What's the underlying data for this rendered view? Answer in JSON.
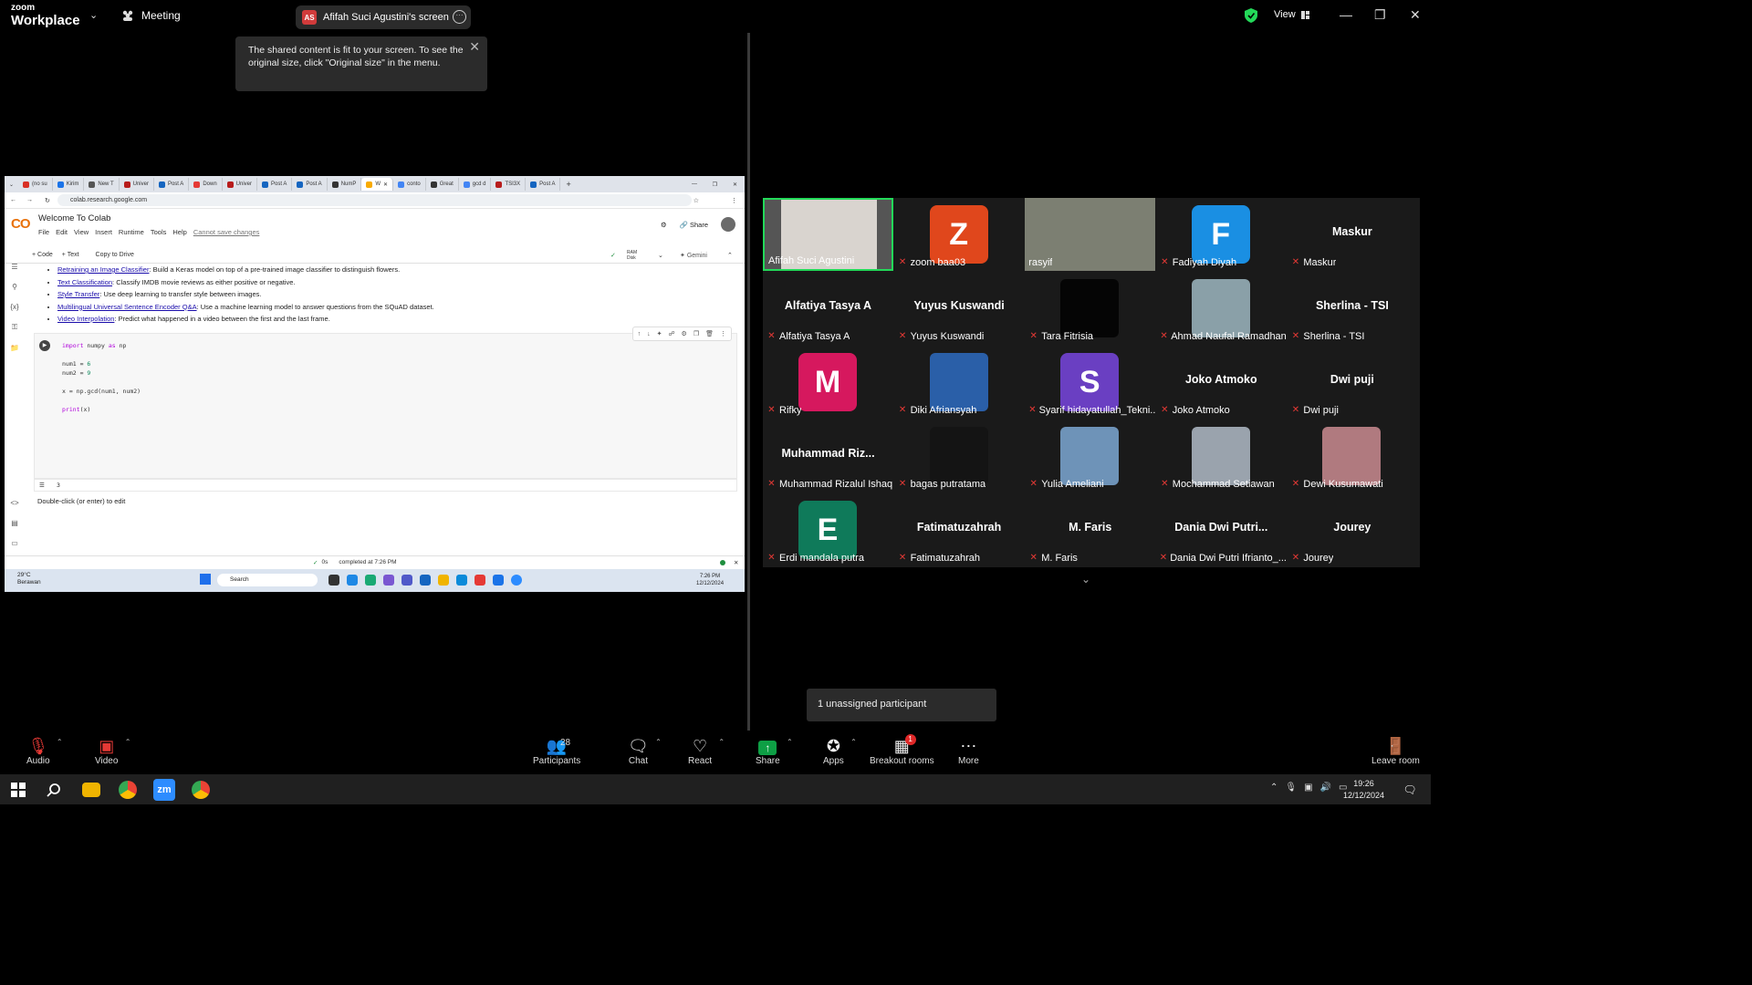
{
  "app": {
    "logo_top": "zoom",
    "logo_bottom": "Workplace",
    "meeting_label": "Meeting",
    "view_label": "View"
  },
  "share_pill": {
    "initials": "AS",
    "label": "Afifah Suci Agustini's screen"
  },
  "tooltip": {
    "text": "The shared content is fit to your screen. To see the original size, click \"Original size\" in the menu."
  },
  "shared": {
    "tabs": [
      "(no su",
      "Kirim",
      "New T",
      "Univer",
      "Post A",
      "Down",
      "Univer",
      "Post A",
      "Post A",
      "NumP",
      "W",
      "conto",
      "Great",
      "gcd d",
      "TSI3X",
      "Post A"
    ],
    "tab_colors": [
      "#d93025",
      "#1a73e8",
      "#555",
      "#b71c1c",
      "#1565c0",
      "#e53935",
      "#b71c1c",
      "#1565c0",
      "#1565c0",
      "#333",
      "#f9ab00",
      "#4285f4",
      "#333",
      "#4285f4",
      "#b71c1c",
      "#1565c0"
    ],
    "url": "colab.research.google.com",
    "colab_logo": "CO",
    "notebook_title": "Welcome To Colab",
    "menu": [
      "File",
      "Edit",
      "View",
      "Insert",
      "Runtime",
      "Tools",
      "Help"
    ],
    "readonly_note": "Cannot save changes",
    "share": "Share",
    "add_code": "+ Code",
    "add_text": "+ Text",
    "copy_drive": "Copy to Drive",
    "ram": "RAM",
    "disk": "Disk",
    "gemini": "Gemini",
    "bullets": [
      {
        "link": "Retraining an Image Classifier",
        "text": ": Build a Keras model on top of a pre-trained image classifier to distinguish flowers."
      },
      {
        "link": "Text Classification",
        "text": ": Classify IMDB movie reviews as either positive or negative."
      },
      {
        "link": "Style Transfer",
        "text": ": Use deep learning to transfer style between images."
      },
      {
        "link": "Multilingual Universal Sentence Encoder Q&A",
        "text": ": Use a machine learning model to answer questions from the SQuAD dataset."
      },
      {
        "link": "Video Interpolation",
        "text": ": Predict what happened in a video between the first and the last frame."
      }
    ],
    "code": {
      "l1_kw": "import",
      "l1_rest": " numpy ",
      "l1_as": "as",
      "l1_np": " np",
      "l2": "num1 = ",
      "l2_n": "6",
      "l3": "num2 = ",
      "l3_n": "9",
      "l4": "x = np.gcd(num1, num2)",
      "l5_kw": "print",
      "l5_rest": "(x)"
    },
    "output": "3",
    "hint": "Double-click (or enter) to edit",
    "status_time": "0s",
    "status_text": "completed at 7:26 PM",
    "weather_temp": "29°C",
    "weather_desc": "Berawan",
    "search_label": "Search",
    "inner_clock_time": "7:26 PM",
    "inner_clock_date": "12/12/2024"
  },
  "gallery": [
    {
      "name": "Afifah Suci Agustini",
      "kind": "video",
      "muted": false,
      "active": true
    },
    {
      "name": "zoom baa03",
      "kind": "avatar",
      "letter": "Z",
      "color": "#e0471c",
      "muted": true
    },
    {
      "name": "rasyif",
      "kind": "video",
      "muted": false
    },
    {
      "name": "Fadiyah Diyah",
      "kind": "avatar",
      "letter": "F",
      "color": "#1a8fe3",
      "muted": true
    },
    {
      "name": "Maskur",
      "kind": "name",
      "big": "Maskur",
      "muted": true
    },
    {
      "name": "Alfatiya Tasya A",
      "kind": "name",
      "big": "Alfatiya Tasya A",
      "muted": true
    },
    {
      "name": "Yuyus Kuswandi",
      "kind": "name",
      "big": "Yuyus Kuswandi",
      "muted": true
    },
    {
      "name": "Tara Fitrisia",
      "kind": "photo",
      "color": "#050505",
      "muted": true
    },
    {
      "name": "Ahmad Naufal Ramadhan",
      "kind": "photo",
      "color": "#8aa0a8",
      "muted": true
    },
    {
      "name": "Sherlina - TSI",
      "kind": "name",
      "big": "Sherlina - TSI",
      "muted": true
    },
    {
      "name": "Rifky",
      "kind": "avatar",
      "letter": "M",
      "color": "#d6185e",
      "muted": true
    },
    {
      "name": "Diki Afriansyah",
      "kind": "photo",
      "color": "#2a5fa8",
      "muted": true
    },
    {
      "name": "Syarif hidayatullah_Tekni...",
      "kind": "avatar",
      "letter": "S",
      "color": "#6a3fc2",
      "muted": true
    },
    {
      "name": "Joko Atmoko",
      "kind": "name",
      "big": "Joko Atmoko",
      "muted": true
    },
    {
      "name": "Dwi puji",
      "kind": "name",
      "big": "Dwi puji",
      "muted": true
    },
    {
      "name": "Muhammad Rizalul Ishaq",
      "kind": "name",
      "big": "Muhammad  Riz...",
      "muted": true
    },
    {
      "name": "bagas putratama",
      "kind": "photo",
      "color": "#141414",
      "muted": true
    },
    {
      "name": "Yulia Ameliani",
      "kind": "photo",
      "color": "#6e93b8",
      "muted": true
    },
    {
      "name": "Mochammad Setiawan",
      "kind": "photo",
      "color": "#9aa3ad",
      "muted": true
    },
    {
      "name": "Dewi Kusumawati",
      "kind": "photo",
      "color": "#b07a7f",
      "muted": true
    },
    {
      "name": "Erdi mandala putra",
      "kind": "avatar",
      "letter": "E",
      "color": "#0f7a5a",
      "muted": true
    },
    {
      "name": "Fatimatuzahrah",
      "kind": "name",
      "big": "Fatimatuzahrah",
      "muted": true
    },
    {
      "name": "M. Faris",
      "kind": "name",
      "big": "M. Faris",
      "muted": true
    },
    {
      "name": "Dania Dwi Putri Ifrianto_...",
      "kind": "name",
      "big": "Dania  Dwi  Putri...",
      "muted": true
    },
    {
      "name": "Jourey",
      "kind": "name",
      "big": "Jourey",
      "muted": true
    }
  ],
  "unassigned": "1 unassigned participant",
  "controls": {
    "audio": "Audio",
    "video": "Video",
    "participants": "Participants",
    "participant_count": "28",
    "chat": "Chat",
    "react": "React",
    "share": "Share",
    "apps": "Apps",
    "breakout": "Breakout rooms",
    "breakout_badge": "1",
    "more": "More",
    "leave": "Leave room"
  },
  "taskbar": {
    "time": "19:26",
    "date": "12/12/2024",
    "notif_count": "1"
  },
  "colors": {
    "accent_green": "#23d959",
    "mic_off_red": "#e53935",
    "share_green": "#0e9f45"
  }
}
